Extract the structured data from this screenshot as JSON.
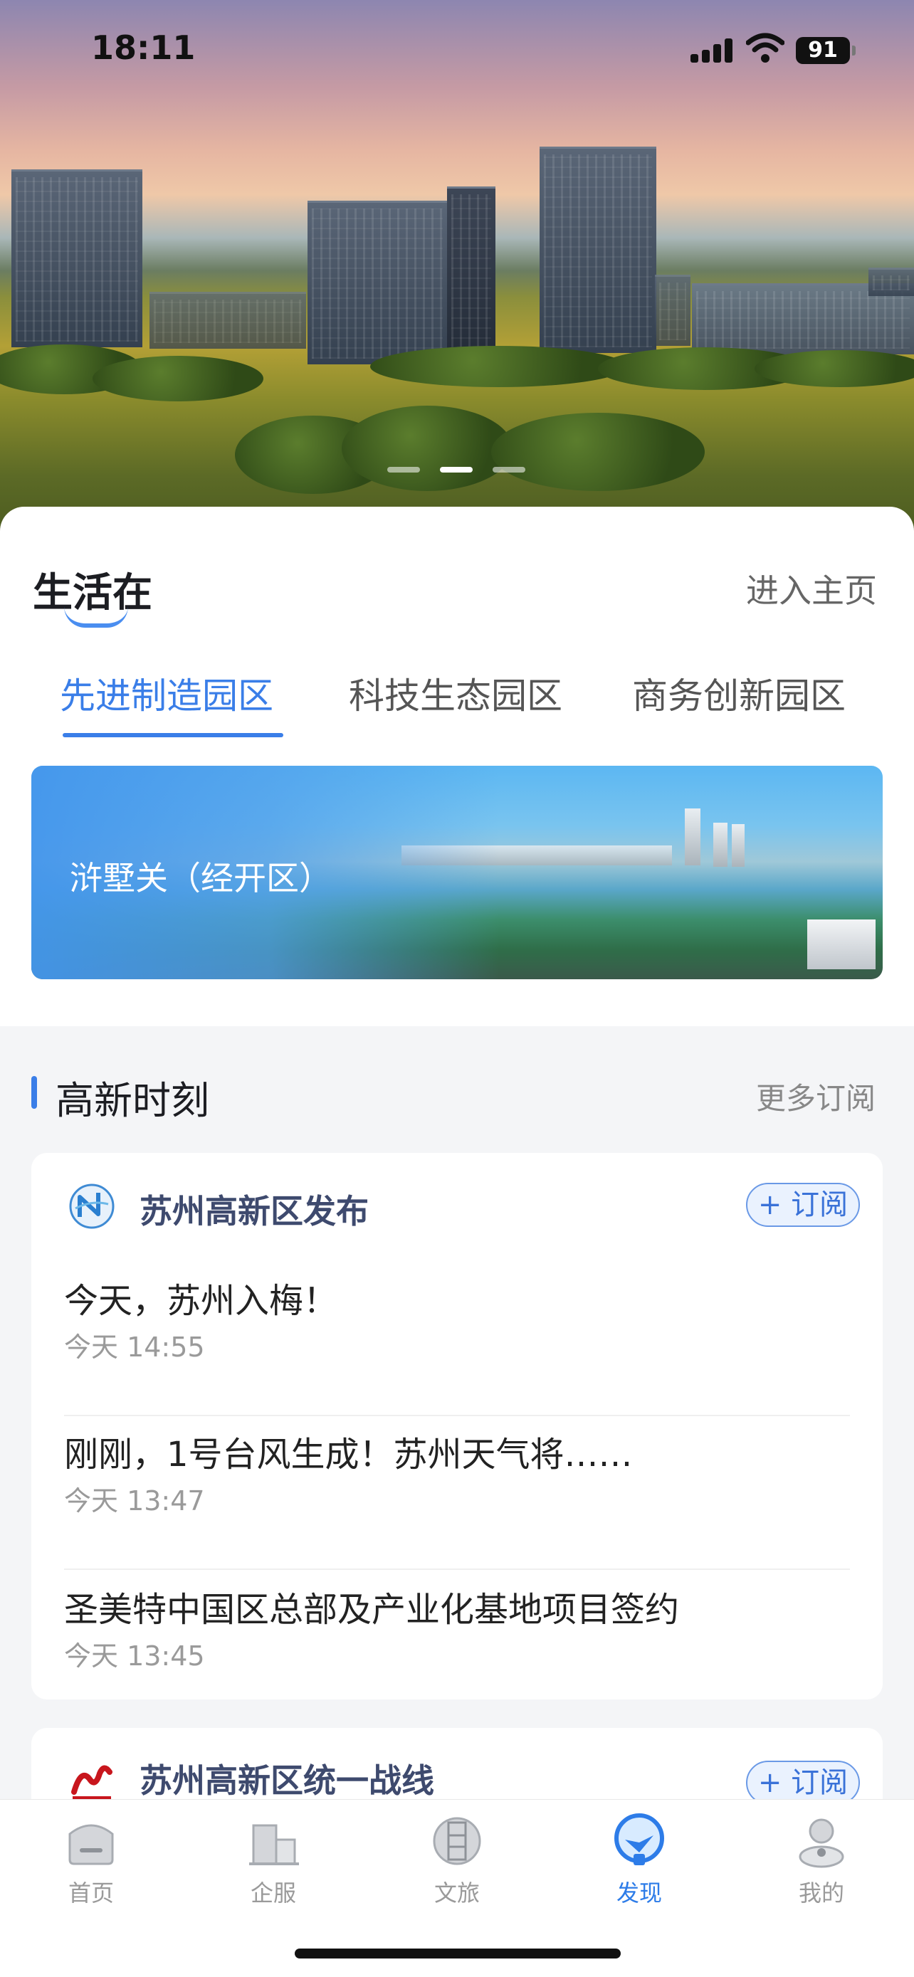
{
  "status_bar": {
    "time": "18:11",
    "battery": "91"
  },
  "life": {
    "title": "生活在",
    "enter_home": "进入主页",
    "tabs": [
      {
        "label": "先进制造园区",
        "active": true
      },
      {
        "label": "科技生态园区",
        "active": false
      },
      {
        "label": "商务创新园区",
        "active": false
      }
    ],
    "banner_label": "浒墅关（经开区）"
  },
  "news": {
    "title": "高新时刻",
    "more": "更多订阅",
    "sources": [
      {
        "name": "苏州高新区发布",
        "subscribe": "+ 订阅",
        "items": [
          {
            "title": "今天，苏州入梅！",
            "time": "今天 14:55"
          },
          {
            "title": "刚刚，1号台风生成！苏州天气将……",
            "time": "今天 13:47"
          },
          {
            "title": "圣美特中国区总部及产业化基地项目签约",
            "time": "今天 13:45"
          }
        ]
      },
      {
        "name": "苏州高新区统一战线",
        "subscribe": "+ 订阅",
        "items": []
      }
    ]
  },
  "tabbar": {
    "items": [
      {
        "label": "首页",
        "icon": "home-icon"
      },
      {
        "label": "企服",
        "icon": "building-icon"
      },
      {
        "label": "文旅",
        "icon": "culture-icon"
      },
      {
        "label": "发现",
        "icon": "discover-icon",
        "active": true
      },
      {
        "label": "我的",
        "icon": "profile-icon"
      }
    ]
  },
  "colors": {
    "accent": "#3a7ee8",
    "tab_inactive": "#9a9a9a"
  }
}
